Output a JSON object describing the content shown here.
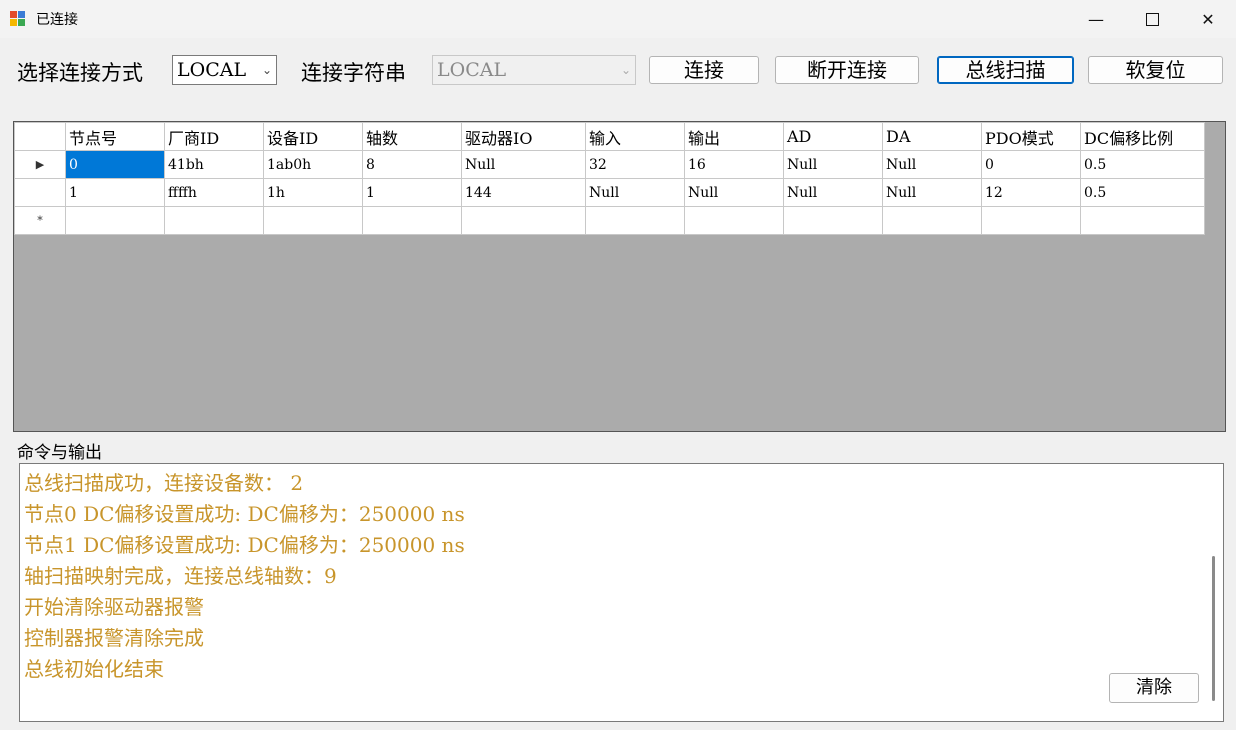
{
  "window": {
    "title": "已连接"
  },
  "toolbar": {
    "conn_method_label": "选择连接方式",
    "conn_method_value": "LOCAL",
    "conn_string_label": "连接字符串",
    "conn_string_value": "LOCAL",
    "connect_label": "连接",
    "disconnect_label": "断开连接",
    "bus_scan_label": "总线扫描",
    "soft_reset_label": "软复位"
  },
  "grid": {
    "columns": [
      "节点号",
      "厂商ID",
      "设备ID",
      "轴数",
      "驱动器IO",
      "输入",
      "输出",
      "AD",
      "DA",
      "PDO模式",
      "DC偏移比例"
    ],
    "rows": [
      [
        "0",
        "41bh",
        "1ab0h",
        "8",
        "Null",
        "32",
        "16",
        "Null",
        "Null",
        "0",
        "0.5"
      ],
      [
        "1",
        "ffffh",
        "1h",
        "1",
        "144",
        "Null",
        "Null",
        "Null",
        "Null",
        "12",
        "0.5"
      ]
    ],
    "current_row_marker": "▶",
    "new_row_marker": "*"
  },
  "output": {
    "group_label": "命令与输出",
    "lines": [
      "总线扫描成功，连接设备数：     2",
      "节点0 DC偏移设置成功: DC偏移为：250000 ns",
      "节点1 DC偏移设置成功: DC偏移为：250000 ns",
      "轴扫描映射完成，连接总线轴数：9",
      "开始清除驱动器报警",
      "控制器报警清除完成",
      "总线初始化结束"
    ],
    "clear_label": "清除"
  },
  "colors": {
    "output_text": "#c8952b",
    "selection": "#0078d7",
    "grid_background": "#ababab"
  }
}
